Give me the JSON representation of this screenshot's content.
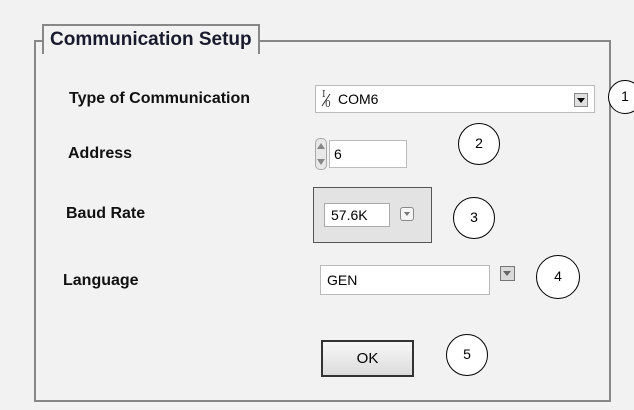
{
  "group": {
    "title": "Communication Setup"
  },
  "fields": {
    "type_label": "Type of Communication",
    "type_value": "COM6",
    "address_label": "Address",
    "address_value": "6",
    "baud_label": "Baud Rate",
    "baud_value": "57.6K",
    "language_label": "Language",
    "language_value": "GEN"
  },
  "buttons": {
    "ok_label": "OK"
  },
  "callouts": [
    "1",
    "2",
    "3",
    "4",
    "5"
  ],
  "icons": {
    "visa_icon_glyph": "I/O",
    "dropdown": "chevron-down-icon",
    "spinner": "increment-decrement-icon"
  }
}
